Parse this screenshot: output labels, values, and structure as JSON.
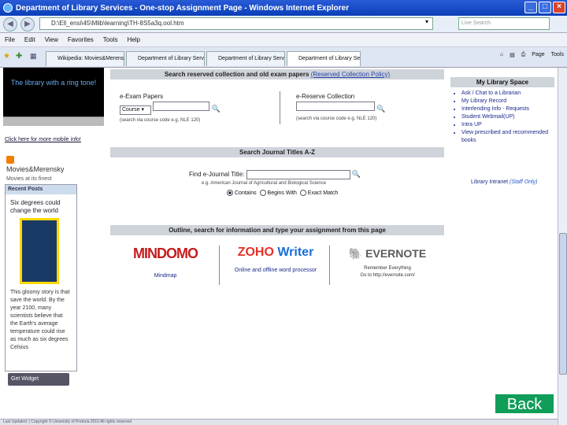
{
  "window": {
    "title": "Department of Library Services - One-stop Assignment Page - Windows Internet Explorer",
    "address": "D:\\Ell_ensi\\45\\Mlib\\learning\\TH-8S5a3q.ool.htm",
    "search_placeholder": "Live Search",
    "minimize": "_",
    "maximize": "□",
    "close": "×"
  },
  "menu": {
    "items": [
      "File",
      "Edit",
      "View",
      "Favorites",
      "Tools",
      "Help"
    ]
  },
  "tabs": [
    {
      "label": "Wikipedia: Movies&Merensky..."
    },
    {
      "label": "Department of Library Servic..."
    },
    {
      "label": "Department of Library Servic..."
    },
    {
      "label": "Department of Library Se..."
    }
  ],
  "toolbar": {
    "page": "Page",
    "tools": "Tools"
  },
  "left": {
    "video_caption": "The library with a ring tone!",
    "mobile_link": "Click here for more mobile info!",
    "widget_title": "Movies&Merensky",
    "widget_subtitle": "Movies at its finest",
    "recent_posts": "Recent Posts",
    "post_title": "Six degrees could change the world",
    "post_text": "This gloomy story is that save the world. By the year 2100, many scientists believe that the Earth's average temperature could rise as much as six degrees Celsius",
    "get_widget": "Get Widget"
  },
  "exam": {
    "bar_text": "Search reserved collection and old exam papers",
    "bar_link": "(Reserved Collection Policy)",
    "papers_label": "e-Exam Papers",
    "papers_select": "Course",
    "papers_hint": "(search via course code e.g. NLE 120)",
    "reserve_label": "e-Reserve Collection",
    "reserve_hint": "(search via course code e.g. NLE 120)"
  },
  "journal": {
    "bar_text": "Search Journal Titles A-Z",
    "field_label": "Find e-Journal Title:",
    "example": "e.g. American Journal of Agricultural and Biological Science",
    "options": [
      "Contains",
      "Begins With",
      "Exact Match"
    ]
  },
  "tools_section": {
    "bar_text": "Outline, search for information and type your assignment from this page",
    "mindomo_logo": "MINDOMO",
    "mindomo_link": "Mindmap",
    "zoho_logo_z": "ZOHO",
    "zoho_logo_w": "Writer",
    "zoho_link": "Online and offline word processor",
    "evernote_logo": "EVERNOTE",
    "evernote_desc1": "Remember Everything",
    "evernote_desc2": "Go to http://evernote.com/"
  },
  "myspace": {
    "title": "My Library Space",
    "items": [
      "Ask / Chat to a Librarian",
      "My Library Record",
      "Interlending Info - Requests",
      "Student Webmail(UP)",
      "Intra UP",
      "View prescribed and recommended books"
    ],
    "journal_link": "Library Intranet",
    "journal_note": "(Staff Only)"
  },
  "back_button": "Back",
  "status_text": "Last Updated: | Copyright © University of Pretoria 2010 All rights reserved"
}
